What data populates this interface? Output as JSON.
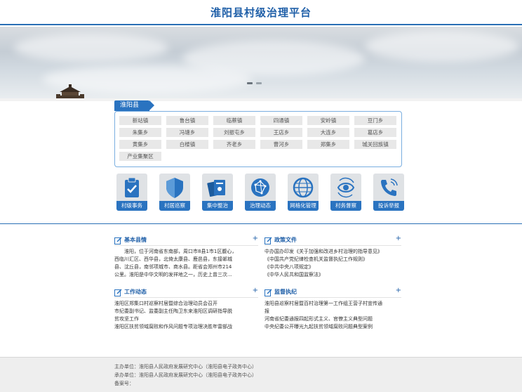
{
  "site": {
    "title": "淮阳县村级治理平台"
  },
  "region": {
    "tab_label": "淮阳县",
    "towns": [
      "新站镇",
      "鲁台镇",
      "临蔡镇",
      "四通镇",
      "安岭镇",
      "豆门乡",
      "朱集乡",
      "冯塘乡",
      "刘振屯乡",
      "王店乡",
      "大连乡",
      "葛店乡",
      "黄集乡",
      "白楼镇",
      "齐老乡",
      "曹河乡",
      "郑集乡",
      "城关回族镇",
      "产业集聚区"
    ]
  },
  "shortcuts": [
    {
      "label": "村级事务",
      "icon": "clipboard-check-icon"
    },
    {
      "label": "村居巡察",
      "icon": "shield-icon"
    },
    {
      "label": "集中整治",
      "icon": "cards-icon"
    },
    {
      "label": "治理动态",
      "icon": "network-globe-icon"
    },
    {
      "label": "网格化管理",
      "icon": "grid-globe-icon"
    },
    {
      "label": "村务督察",
      "icon": "eye-refresh-icon"
    },
    {
      "label": "投诉举报",
      "icon": "phone-icon"
    }
  ],
  "sections": {
    "basic": {
      "title": "基本县情",
      "lines": [
        "淮阳，位于河南省东南部，周口市8县1市1区腹心，",
        "西临川汇区、西华县，北倚太康县、鹿邑县，东接郸城",
        "县、沈丘县，南邻项城市、商水县。距省会郑州市214",
        "公里。淮阳是中华文明的发祥地之一，历史上曾三次..."
      ]
    },
    "policy": {
      "title": "政策文件",
      "lines": [
        "中办国办印发《关于加强和改进乡村治理的指导意见》",
        "《中国共产党纪律检查机关监督执纪工作规则》",
        "《中共中央八项规定》",
        "《中华人民共和国监察法》"
      ]
    },
    "work": {
      "title": "工作动态",
      "lines": [
        "淮阳区郑集口村巡察村居暨综合治理动员会召开",
        "市纪委副书记、监委副主任陶卫东来淮阳区调研指导脱",
        "贫攻坚工作",
        "淮阳区扶贫领域腐败和作风问题专项治理决胜年雷部战"
      ]
    },
    "supervise": {
      "title": "监督执纪",
      "lines": [
        "淮阳县巡察村居暨百村治理第一工作组王营子村宣传通",
        "报",
        "河南省纪委通报四起形式主义、官僚主义典型问题",
        "中央纪委公开曝光九起扶贫领域腐败问题典型案例"
      ]
    },
    "plus_label": "+"
  },
  "footer": {
    "host": "主办单位：淮阳县人民政府发展研究中心（淮阳县电子政务中心）",
    "organizer": "承办单位：淮阳县人民政府发展研究中心（淮阳县电子政务中心）",
    "icp": "备案号："
  }
}
